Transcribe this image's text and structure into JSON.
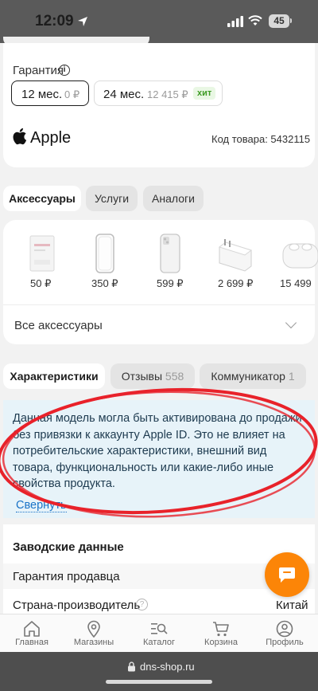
{
  "status": {
    "time": "12:09",
    "battery": "45"
  },
  "warranty": {
    "label": "Гарантия",
    "options": [
      {
        "name": "12 мес.",
        "price": "0 ₽"
      },
      {
        "name": "24 мес.",
        "price": "12 415 ₽",
        "badge": "хит"
      }
    ]
  },
  "product": {
    "brand": "Apple",
    "sku_label": "Код товара: 5432115"
  },
  "tabs_top": [
    "Аксессуары",
    "Услуги",
    "Аналоги"
  ],
  "accessories": {
    "items": [
      {
        "price": "50 ₽",
        "icon": "glass-film-icon"
      },
      {
        "price": "350 ₽",
        "icon": "clear-case-icon"
      },
      {
        "price": "599 ₽",
        "icon": "phone-case-icon"
      },
      {
        "price": "2 699 ₽",
        "icon": "charger-icon"
      },
      {
        "price": "15 499",
        "icon": "earbuds-icon"
      }
    ],
    "all_label": "Все аксессуары"
  },
  "tabs_bottom": [
    {
      "label": "Характеристики",
      "count": ""
    },
    {
      "label": "Отзывы",
      "count": "558"
    },
    {
      "label": "Коммуникатор",
      "count": "1"
    }
  ],
  "notice": {
    "text": "Данная модель могла быть активирована до продажи без привязки к аккаунту Apple ID. Это не влияет на потребительские характеристики, внешний вид товара, функциональность или какие-либо иные свойства продукта.",
    "collapse": "Свернуть"
  },
  "specs": {
    "title": "Заводские данные",
    "rows": [
      {
        "label": "Гарантия продавца",
        "value": ""
      },
      {
        "label": "Страна-производитель",
        "value": "Китай"
      }
    ]
  },
  "bottom_nav": [
    "Главная",
    "Магазины",
    "Каталог",
    "Корзина",
    "Профиль"
  ],
  "browser": {
    "url": "dns-shop.ru"
  },
  "colors": {
    "accent": "#fc8507",
    "link": "#1a73c7",
    "notice_bg": "#e7f3f9",
    "annotation": "#e8222a"
  }
}
